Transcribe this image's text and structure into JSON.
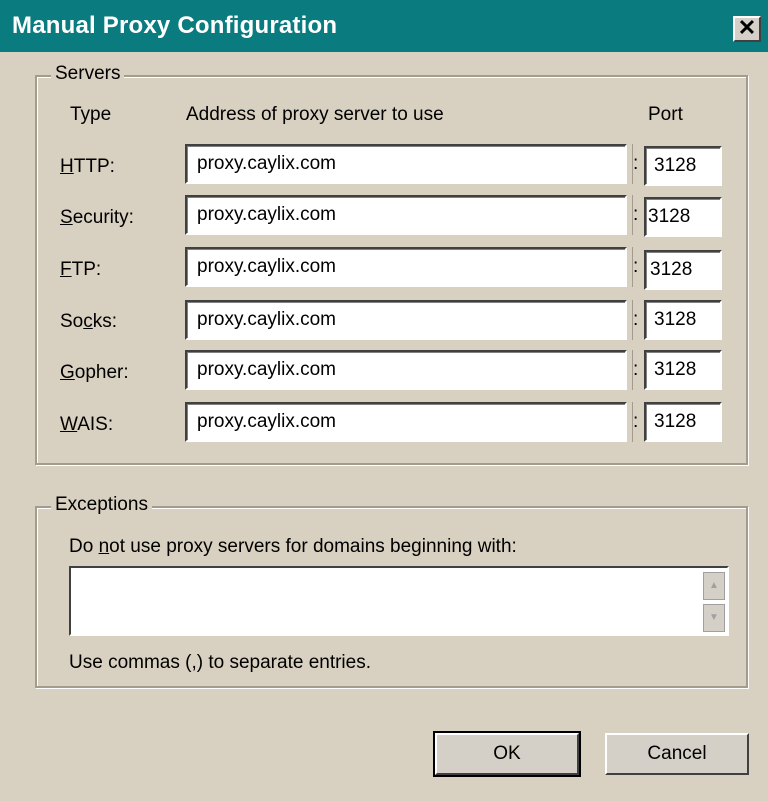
{
  "window": {
    "title": "Manual Proxy Configuration",
    "close_label": "✕"
  },
  "servers": {
    "legend": "Servers",
    "headers": {
      "type": "Type",
      "address": "Address of proxy server to use",
      "port": "Port"
    },
    "rows": [
      {
        "type_label": "HTTP:",
        "mnemonic": "H",
        "rest": "TTP:",
        "address": "proxy.caylix.com",
        "port": "3128"
      },
      {
        "type_label": "Security:",
        "mnemonic": "S",
        "rest": "ecurity:",
        "address": "proxy.caylix.com",
        "port": "3128"
      },
      {
        "type_label": "FTP:",
        "mnemonic": "F",
        "rest": "TP:",
        "address": "proxy.caylix.com",
        "port": "3128"
      },
      {
        "type_label": "Socks:",
        "mnemonic": "c",
        "pre": "So",
        "rest": "ks:",
        "address": "proxy.caylix.com",
        "port": "3128"
      },
      {
        "type_label": "Gopher:",
        "mnemonic": "G",
        "rest": "opher:",
        "address": "proxy.caylix.com",
        "port": "3128"
      },
      {
        "type_label": "WAIS:",
        "mnemonic": "W",
        "rest": "AIS:",
        "address": "proxy.caylix.com",
        "port": "3128"
      }
    ],
    "separator": ":"
  },
  "exceptions": {
    "legend": "Exceptions",
    "instruction_pre": "Do ",
    "instruction_mnemonic": "n",
    "instruction_post": "ot use proxy servers for domains beginning with:",
    "value": "",
    "hint": "Use commas (,) to separate entries."
  },
  "buttons": {
    "ok": "OK",
    "cancel": "Cancel"
  }
}
